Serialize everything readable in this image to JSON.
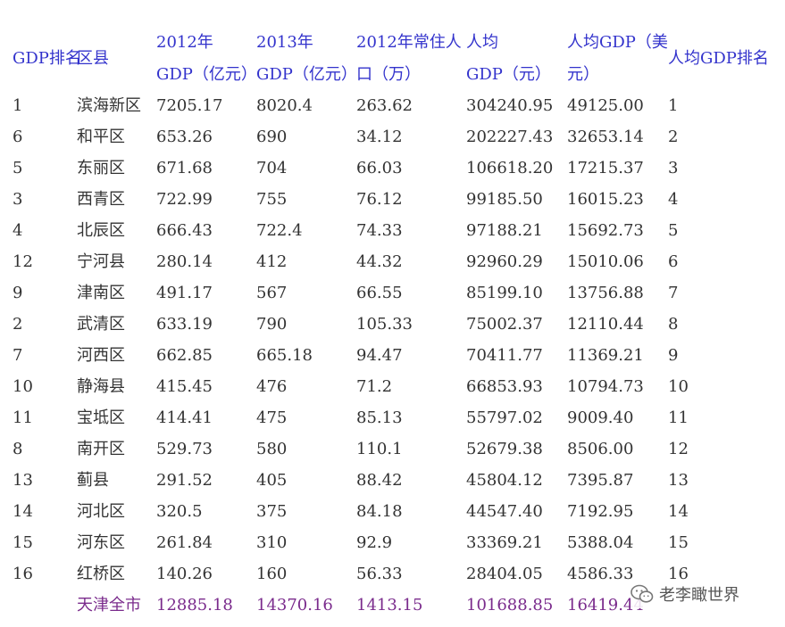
{
  "header": {
    "col0": "GDP排名",
    "col1": "区县",
    "col2_line1": "2012年",
    "col2_line2": "GDP（亿元）",
    "col3_line1": "2013年",
    "col3_line2": "GDP（亿元）",
    "col4_line1": "2012年常住人",
    "col4_line2": "口（万）",
    "col5_line1": "人均",
    "col5_line2": "GDP（元）",
    "col6_line1": "人均GDP（美",
    "col6_line2": "元）",
    "col7": "人均GDP排名"
  },
  "rows": [
    {
      "gdp_rank": "1",
      "district": "滨海新区",
      "gdp2012": "7205.17",
      "gdp2013": "8020.4",
      "pop2012": "263.62",
      "per_capita_cny": "304240.95",
      "per_capita_usd": "49125.00",
      "per_capita_rank": "1"
    },
    {
      "gdp_rank": "6",
      "district": "和平区",
      "gdp2012": "653.26",
      "gdp2013": "690",
      "pop2012": "34.12",
      "per_capita_cny": "202227.43",
      "per_capita_usd": "32653.14",
      "per_capita_rank": "2"
    },
    {
      "gdp_rank": "5",
      "district": "东丽区",
      "gdp2012": "671.68",
      "gdp2013": "704",
      "pop2012": "66.03",
      "per_capita_cny": "106618.20",
      "per_capita_usd": "17215.37",
      "per_capita_rank": "3"
    },
    {
      "gdp_rank": "3",
      "district": "西青区",
      "gdp2012": "722.99",
      "gdp2013": "755",
      "pop2012": "76.12",
      "per_capita_cny": "99185.50",
      "per_capita_usd": "16015.23",
      "per_capita_rank": "4"
    },
    {
      "gdp_rank": "4",
      "district": "北辰区",
      "gdp2012": "666.43",
      "gdp2013": "722.4",
      "pop2012": "74.33",
      "per_capita_cny": "97188.21",
      "per_capita_usd": "15692.73",
      "per_capita_rank": "5"
    },
    {
      "gdp_rank": "12",
      "district": "宁河县",
      "gdp2012": "280.14",
      "gdp2013": "412",
      "pop2012": "44.32",
      "per_capita_cny": "92960.29",
      "per_capita_usd": "15010.06",
      "per_capita_rank": "6"
    },
    {
      "gdp_rank": "9",
      "district": "津南区",
      "gdp2012": "491.17",
      "gdp2013": "567",
      "pop2012": "66.55",
      "per_capita_cny": "85199.10",
      "per_capita_usd": "13756.88",
      "per_capita_rank": "7"
    },
    {
      "gdp_rank": "2",
      "district": "武清区",
      "gdp2012": "633.19",
      "gdp2013": "790",
      "pop2012": "105.33",
      "per_capita_cny": "75002.37",
      "per_capita_usd": "12110.44",
      "per_capita_rank": "8"
    },
    {
      "gdp_rank": "7",
      "district": "河西区",
      "gdp2012": "662.85",
      "gdp2013": "665.18",
      "pop2012": "94.47",
      "per_capita_cny": "70411.77",
      "per_capita_usd": "11369.21",
      "per_capita_rank": "9"
    },
    {
      "gdp_rank": "10",
      "district": "静海县",
      "gdp2012": "415.45",
      "gdp2013": "476",
      "pop2012": "71.2",
      "per_capita_cny": "66853.93",
      "per_capita_usd": "10794.73",
      "per_capita_rank": "10"
    },
    {
      "gdp_rank": "11",
      "district": "宝坻区",
      "gdp2012": "414.41",
      "gdp2013": "475",
      "pop2012": "85.13",
      "per_capita_cny": "55797.02",
      "per_capita_usd": "9009.40",
      "per_capita_rank": "11"
    },
    {
      "gdp_rank": "8",
      "district": "南开区",
      "gdp2012": "529.73",
      "gdp2013": "580",
      "pop2012": "110.1",
      "per_capita_cny": "52679.38",
      "per_capita_usd": "8506.00",
      "per_capita_rank": "12"
    },
    {
      "gdp_rank": "13",
      "district": "蓟县",
      "gdp2012": "291.52",
      "gdp2013": "405",
      "pop2012": "88.42",
      "per_capita_cny": "45804.12",
      "per_capita_usd": "7395.87",
      "per_capita_rank": "13"
    },
    {
      "gdp_rank": "14",
      "district": "河北区",
      "gdp2012": "320.5",
      "gdp2013": "375",
      "pop2012": "84.18",
      "per_capita_cny": "44547.40",
      "per_capita_usd": "7192.95",
      "per_capita_rank": "14"
    },
    {
      "gdp_rank": "15",
      "district": "河东区",
      "gdp2012": "261.84",
      "gdp2013": "310",
      "pop2012": "92.9",
      "per_capita_cny": "33369.21",
      "per_capita_usd": "5388.04",
      "per_capita_rank": "15"
    },
    {
      "gdp_rank": "16",
      "district": "红桥区",
      "gdp2012": "140.26",
      "gdp2013": "160",
      "pop2012": "56.33",
      "per_capita_cny": "28404.05",
      "per_capita_usd": "4586.33",
      "per_capita_rank": "16"
    }
  ],
  "total": {
    "district": "天津全市",
    "gdp2012": "12885.18",
    "gdp2013": "14370.16",
    "pop2012": "1413.15",
    "per_capita_cny": "101688.85",
    "per_capita_usd": "16419.44"
  },
  "watermark": {
    "text": "老李瞰世界",
    "icon": "wechat-icon",
    "color": "#555555"
  }
}
